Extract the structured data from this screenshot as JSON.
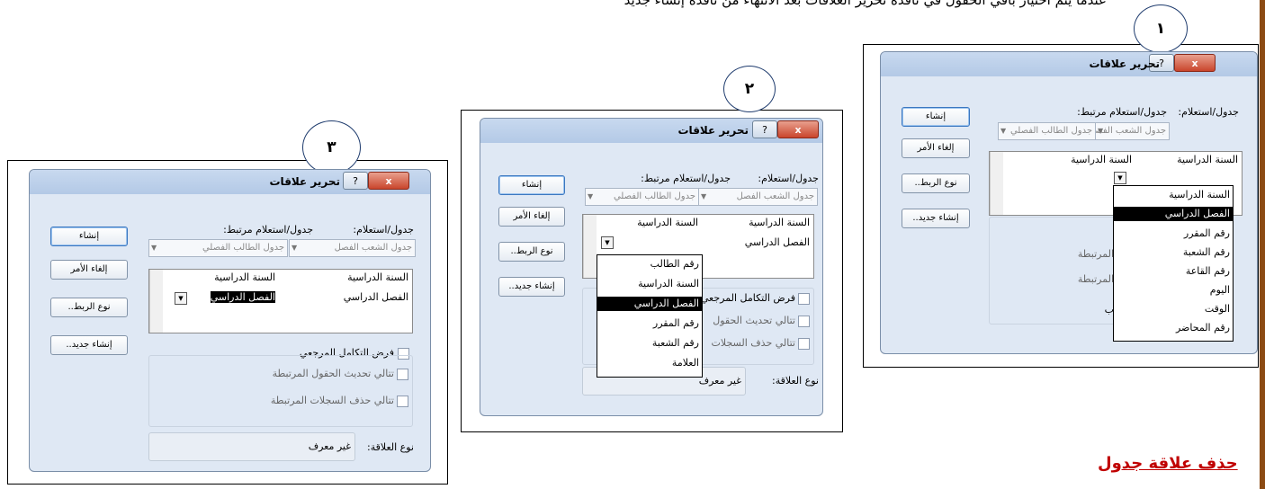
{
  "instruction": "عندما يتم اختيار باقي الحقول في نافذة تحرير العلاقات بعد الانتهاء من نافذة إنشاء جديد",
  "section_heading": "حذف علاقة جدول",
  "step_numbers": [
    "١",
    "٢",
    "٣"
  ],
  "colors": {
    "heading": "#c00000",
    "dialog_bg": "#dfe8f4",
    "accent_border": "#8b4a13"
  },
  "dialog": {
    "title": "تحرير علاقات",
    "close_label": "x",
    "help_label": "?",
    "table_query_label": "جدول/استعلام:",
    "related_table_label": "جدول/استعلام مرتبط:",
    "table_value": "جدول الشعب الفصل",
    "related_value": "جدول الطالب الفصلي",
    "buttons": {
      "create": "إنشاء",
      "cancel": "إلغاء الأمر",
      "join_type": "نوع الربط..",
      "create_new": "إنشاء جديد.."
    },
    "enforce_integrity": "فرض التكامل المرجعي",
    "cascade_update": "تتالي تحديث الحقول المرتبطة",
    "cascade_delete": "تتالي حذف السجلات المرتبطة",
    "cascade_update_short": "تتالي تحديث الحقول",
    "cascade_delete_short": "تتالي حذف السجلات",
    "relationship_type_label": "نوع العلاقة:",
    "relationship_type_value": "غير معرف"
  },
  "dialog1": {
    "grid_left": "السنة الدراسية",
    "grid_right": "السنة الدراسية",
    "dropdown_items": [
      "السنة الدراسية",
      "الفصل الدراسي",
      "رقم المقرر",
      "رقم الشعبة",
      "رقم القاعة",
      "اليوم",
      "الوقت",
      "رقم المحاضر"
    ],
    "selected_index": 1,
    "partial_fragments": [
      "المرتبطة",
      "المرتبطة",
      "ب"
    ]
  },
  "dialog2": {
    "grid_row1_left": "السنة الدراسية",
    "grid_row1_right": "السنة الدراسية",
    "grid_row2_right": "الفصل الدراسي",
    "dropdown_items": [
      "رقم الطالب",
      "السنة الدراسية",
      "الفصل الدراسي",
      "رقم المقرر",
      "رقم الشعبة",
      "العلامة"
    ],
    "selected_index": 2
  },
  "dialog3": {
    "grid_row1_left": "السنة الدراسية",
    "grid_row1_right": "السنة الدراسية",
    "grid_row2_left": "الفصل الدراسي",
    "grid_row2_right": "الفصل الدراسي"
  }
}
